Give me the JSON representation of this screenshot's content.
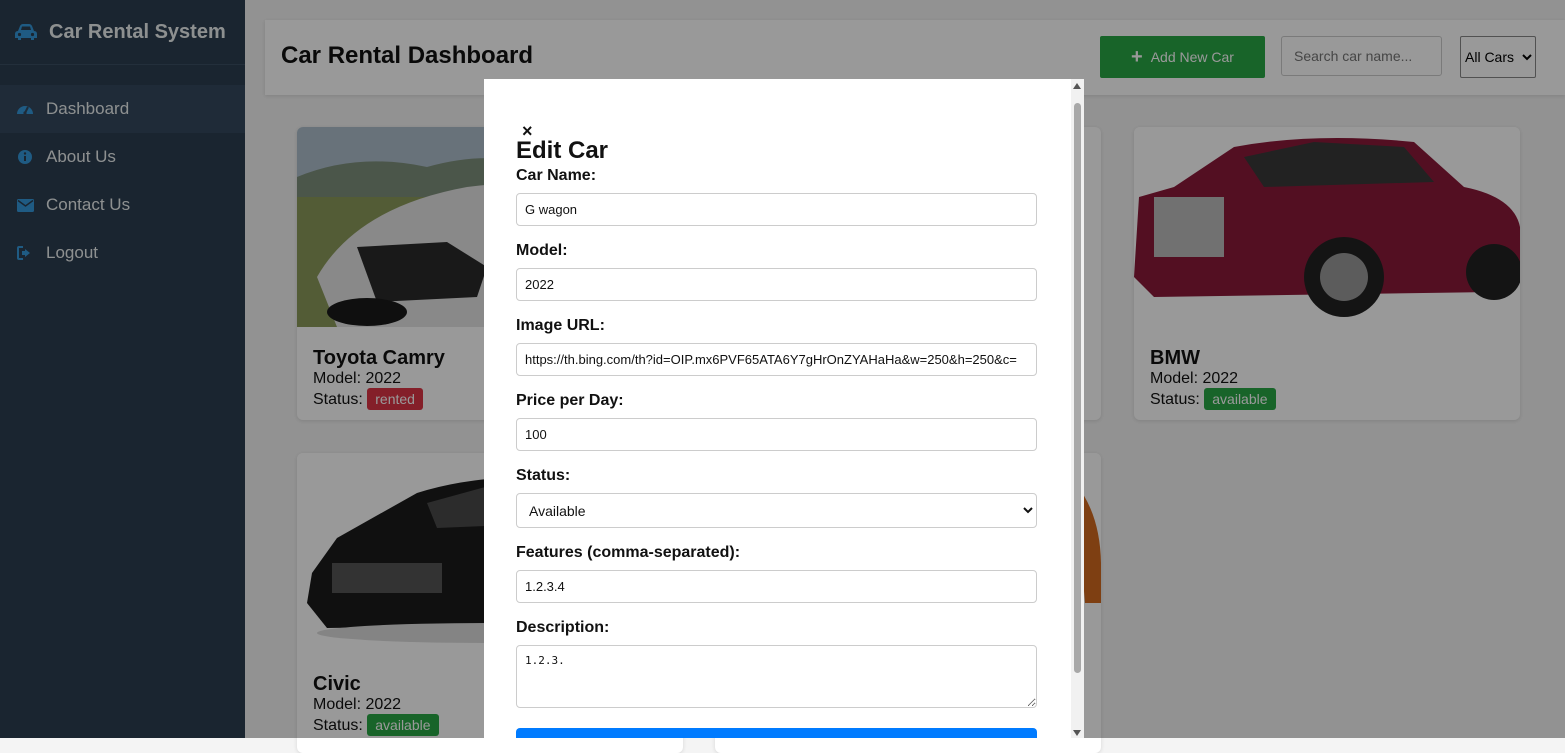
{
  "sidebar": {
    "brand": "Car Rental System",
    "items": [
      {
        "label": "Dashboard",
        "icon": "dashboard-icon",
        "active": true
      },
      {
        "label": "About Us",
        "icon": "info-icon"
      },
      {
        "label": "Contact Us",
        "icon": "envelope-icon"
      },
      {
        "label": "Logout",
        "icon": "logout-icon"
      }
    ]
  },
  "header": {
    "title": "Car Rental Dashboard",
    "add_button": "Add New Car",
    "search_placeholder": "Search car name...",
    "filter_selected": "All Cars"
  },
  "cards": [
    {
      "name": "Toyota Camry",
      "model": "Model: 2022",
      "status_label": "Status:",
      "status": "rented",
      "status_color": "#dc3545"
    },
    {
      "name": "BMW",
      "model": "Model: 2022",
      "status_label": "Status:",
      "status": "available",
      "status_color": "#28a745"
    },
    {
      "name": "Civic",
      "model": "Model: 2022",
      "status_label": "Status:",
      "status": "available",
      "status_color": "#28a745"
    }
  ],
  "modal": {
    "close": "×",
    "title": "Edit Car",
    "car_name_label": "Car Name:",
    "car_name_value": "G wagon",
    "model_label": "Model:",
    "model_value": "2022",
    "image_url_label": "Image URL:",
    "image_url_value": "https://th.bing.com/th?id=OIP.mx6PVF65ATA6Y7gHrOnZYAHaHa&w=250&h=250&c=",
    "price_label": "Price per Day:",
    "price_value": "100",
    "status_label": "Status:",
    "status_value": "Available",
    "features_label": "Features (comma-separated):",
    "features_value": "1.2.3.4",
    "description_label": "Description:",
    "description_value": "1.2.3."
  },
  "colors": {
    "sidebar_bg": "#2c3e50",
    "accent_green": "#28a745",
    "accent_red": "#dc3545",
    "primary_blue": "#007bff"
  }
}
